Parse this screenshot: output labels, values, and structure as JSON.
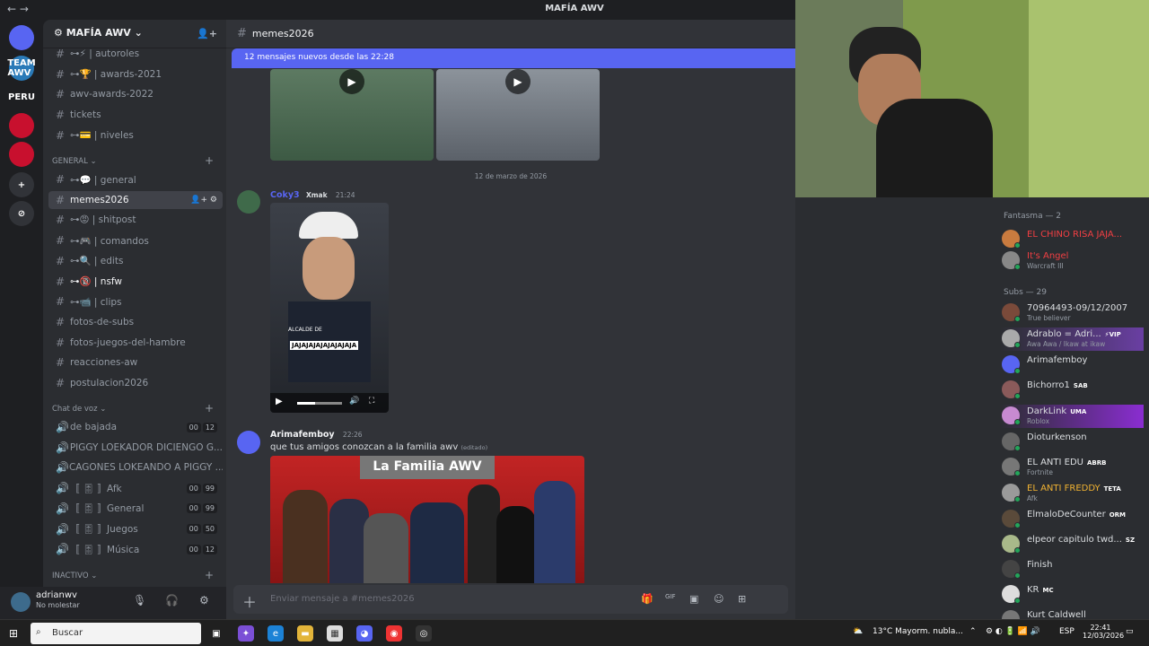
{
  "titlebar": {
    "nav": "← →",
    "title": "MAFÍA AWV"
  },
  "servers": [
    {
      "label": "",
      "color": "#5865f2",
      "icon": "discord-icon"
    },
    {
      "label": "TEAM AWV",
      "color": "#2a7ab8"
    },
    {
      "label": "PERU",
      "color": "#1e1f22"
    },
    {
      "label": "",
      "color": "#c8102e"
    },
    {
      "label": "",
      "color": "#c8102e"
    },
    {
      "label": "+",
      "color": "#313338",
      "icon": "add-server-icon"
    },
    {
      "label": "⊘",
      "color": "#313338",
      "icon": "explore-icon"
    }
  ],
  "guild": {
    "name": "MAFÍA AWV ⌄"
  },
  "channels": [
    {
      "label": "⊶⚡ | autoroles"
    },
    {
      "label": "⊶🏆 | awards-2021"
    },
    {
      "label": "awv-awards-2022",
      "icon": "megaphone-icon"
    },
    {
      "label": "tickets",
      "icon": "megaphone-icon"
    },
    {
      "label": "⊶💳 | niveles"
    }
  ],
  "category_general": "GENERAL ⌄",
  "general_channels": [
    {
      "label": "⊶💬 | general"
    },
    {
      "label": "memes2026",
      "active": true
    },
    {
      "label": "⊶😡 | shitpost"
    },
    {
      "label": "⊶🎮 | comandos"
    },
    {
      "label": "⊶🔍 | edits"
    },
    {
      "label": "⊶🔞 | nsfw",
      "bold": true
    },
    {
      "label": "⊶📹 | clips"
    },
    {
      "label": "fotos-de-subs"
    },
    {
      "label": "fotos-juegos-del-hambre"
    },
    {
      "label": "reacciones-aw"
    },
    {
      "label": "postulacion2026"
    }
  ],
  "category_voice": "Chat de voz ⌄",
  "voice_channels": [
    {
      "label": "de bajada",
      "a": "00",
      "b": "12"
    },
    {
      "label": "PIGGY LOEKADOR DICIENGO G...",
      "a": "",
      "b": ""
    },
    {
      "label": "CAGONES LOKEANDO A PIGGY ...",
      "a": "",
      "b": ""
    },
    {
      "label": "〚 🎚 〛Afk",
      "a": "00",
      "b": "99"
    },
    {
      "label": "〚 🎚 〛General",
      "a": "00",
      "b": "99"
    },
    {
      "label": "〚 🎚 〛Juegos",
      "a": "00",
      "b": "50"
    },
    {
      "label": "〚 🎚 〛Música",
      "a": "00",
      "b": "12"
    }
  ],
  "category_inactive": "INACTIVO ⌄",
  "user": {
    "name": "adrianwv",
    "status": "No molestar"
  },
  "chat": {
    "channel": "memes2026",
    "new_messages": "12 mensajes nuevos desde las 22:28",
    "date_divider": "12 de marzo de 2026",
    "msg1": {
      "author": "Coky3",
      "badge": "Xmak",
      "time": "21:24",
      "author_color": "#5865f2"
    },
    "video_caption": "JAJAJAJAJAJAJAJAJA",
    "video_text": "ALCALDE DE",
    "msg2": {
      "author": "Arimafemboy",
      "time": "22:26",
      "text": "que tus amigos conozcan a la familia awv",
      "edited": "(editado)"
    },
    "image_title": "La Familia AWV",
    "composer_placeholder": "Enviar mensaje a #memes2026"
  },
  "members": {
    "cat_fantasma": "Fantasma — 2",
    "cat_subs": "Subs — 29",
    "list": [
      {
        "name": "EL CHINO RISA JAJA...",
        "sub": "",
        "color": "#f23f43"
      },
      {
        "name": "It's Angel",
        "sub": "Warcraft III",
        "color": "#f23f43"
      },
      {
        "name": "70964493-09/12/2007",
        "sub": "True believer",
        "color": "#dbdee1"
      },
      {
        "name": "Adrablo = Adri...",
        "sub": "Awa Awa / Ikaw at ikaw",
        "color": "#dbdee1",
        "tag": "⚡VIP"
      },
      {
        "name": "Arimafemboy",
        "sub": "",
        "color": "#dbdee1"
      },
      {
        "name": "Bichorro1",
        "sub": "",
        "color": "#dbdee1",
        "tag": "SAB"
      },
      {
        "name": "DarkLink",
        "sub": "Roblox",
        "color": "#dbdee1",
        "tag": "UMA"
      },
      {
        "name": "Dioturkenson",
        "sub": "",
        "color": "#dbdee1"
      },
      {
        "name": "EL ANTI EDU",
        "sub": "Fortnite",
        "color": "#dbdee1",
        "tag": "ABRB"
      },
      {
        "name": "EL ANTI FREDDY",
        "sub": "Afk",
        "color": "#f0b232",
        "tag": "TETA"
      },
      {
        "name": "ElmaloDeCounter",
        "sub": "",
        "color": "#dbdee1",
        "tag": "ORM"
      },
      {
        "name": "elpeor capitulo twd...",
        "sub": "",
        "color": "#dbdee1",
        "tag": "SZ"
      },
      {
        "name": "Finish",
        "sub": "",
        "color": "#dbdee1"
      },
      {
        "name": "KR",
        "sub": "",
        "color": "#dbdee1",
        "tag": "MC"
      },
      {
        "name": "Kurt Caldwell",
        "sub": "",
        "color": "#dbdee1"
      }
    ]
  },
  "taskbar": {
    "search": "Buscar",
    "weather": "13°C  Mayorm. nubla...",
    "lang": "ESP",
    "time": "22:41",
    "date": "12/03/2026"
  }
}
